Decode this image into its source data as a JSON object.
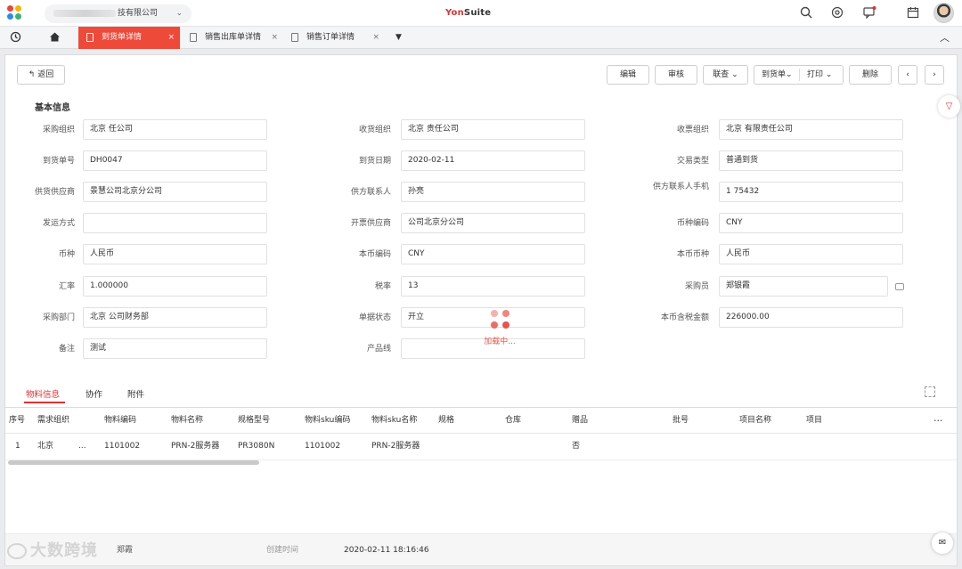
{
  "header": {
    "org_name": "技有限公司",
    "brand_yon": "Yon",
    "brand_suite": "Suite"
  },
  "tabs": [
    {
      "label": "到货单详情",
      "active": true
    },
    {
      "label": "销售出库单详情",
      "active": false
    },
    {
      "label": "销售订单详情",
      "active": false
    }
  ],
  "toolbar": {
    "back": "返回",
    "edit": "编辑",
    "audit": "审核",
    "linked": "联查",
    "arrival_note": "到货单",
    "print": "打印",
    "delete": "删除"
  },
  "section_title": "基本信息",
  "fields": {
    "purchase_org": {
      "label": "采购组织",
      "value": "北京        任公司"
    },
    "receive_org": {
      "label": "收货组织",
      "value": "北京        责任公司"
    },
    "invoice_org": {
      "label": "收票组织",
      "value": "北京        有限责任公司"
    },
    "arrival_no": {
      "label": "到货单号",
      "value": "DH0047"
    },
    "arrival_date": {
      "label": "到货日期",
      "value": "2020-02-11"
    },
    "trade_type": {
      "label": "交易类型",
      "value": "普通到货"
    },
    "supplier": {
      "label": "供货供应商",
      "value": "景慧公司北京分公司"
    },
    "supplier_contact": {
      "label": "供方联系人",
      "value": "孙亮"
    },
    "contact_phone": {
      "label": "供方联系人手机",
      "value": "1        75432"
    },
    "shipping": {
      "label": "发运方式",
      "value": ""
    },
    "invoice_supplier": {
      "label": "开票供应商",
      "value": "   公司北京分公司"
    },
    "currency_code": {
      "label": "币种编码",
      "value": "CNY"
    },
    "currency": {
      "label": "币种",
      "value": "人民币"
    },
    "local_currency_code": {
      "label": "本币编码",
      "value": "CNY"
    },
    "local_currency": {
      "label": "本币币种",
      "value": "人民币"
    },
    "exchange_rate": {
      "label": "汇率",
      "value": "1.000000"
    },
    "tax_rate": {
      "label": "税率",
      "value": "13"
    },
    "purchaser": {
      "label": "采购员",
      "value": "郑银霞"
    },
    "purchase_dept": {
      "label": "采购部门",
      "value": "北京        公司财务部"
    },
    "doc_status": {
      "label": "单据状态",
      "value": "开立"
    },
    "local_total": {
      "label": "本币含税金额",
      "value": "226000.00"
    },
    "remark": {
      "label": "备注",
      "value": "测试"
    },
    "product_line": {
      "label": "产品线",
      "value": ""
    }
  },
  "loading_text": "加载中...",
  "subtabs": [
    "物料信息",
    "协作",
    "附件"
  ],
  "table": {
    "headers": [
      "序号",
      "需求组织",
      "物料编码",
      "物料名称",
      "规格型号",
      "物料sku编码",
      "物料sku名称",
      "规格",
      "仓库",
      "赠品",
      "批号",
      "项目名称",
      "项目"
    ],
    "rows": [
      [
        "1",
        "北京",
        "1101002",
        "PRN-2服务器",
        "PR3080N",
        "1101002",
        "PRN-2服务器",
        "",
        "",
        "否",
        "",
        "",
        ""
      ]
    ],
    "ellipsis": "...",
    "more": "···"
  },
  "footer": {
    "creator_value": "郑霞",
    "created_time_label": "创建时间",
    "created_time_value": "2020-02-11 18:16:46"
  },
  "watermark": "大数跨境"
}
